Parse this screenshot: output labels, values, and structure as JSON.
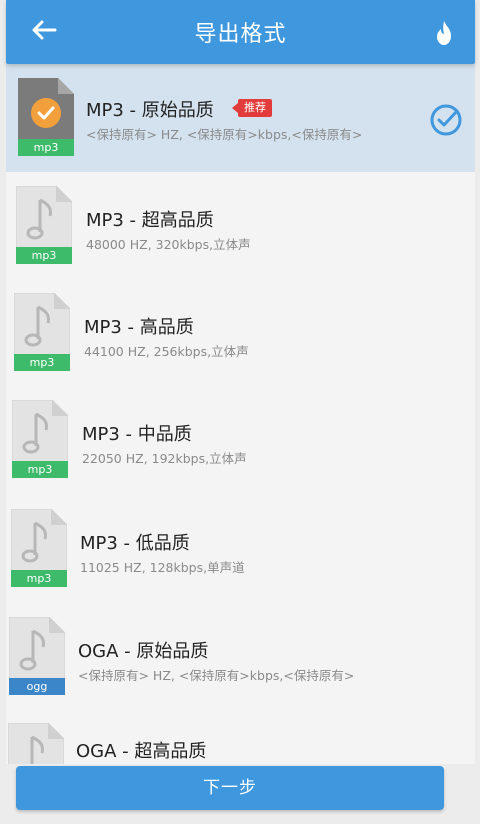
{
  "header": {
    "title": "导出格式",
    "back_icon": "arrow-left-icon",
    "right_icon": "fire-icon"
  },
  "colors": {
    "primary": "#3f98de",
    "selected_row": "#d3e2ee",
    "badge": "#e23b3b",
    "mp3_tag": "#3dbb6b",
    "oga_tag": "#3b86c9",
    "check_orange": "#f2a03c"
  },
  "formats": [
    {
      "title": "MP3 - 原始品质",
      "subtitle": "<保持原有> HZ, <保持原有>kbps,<保持原有>",
      "tag": "mp3",
      "selected": true,
      "badge": "推荐"
    },
    {
      "title": "MP3 - 超高品质",
      "subtitle": "48000 HZ, 320kbps,立体声",
      "tag": "mp3",
      "selected": false
    },
    {
      "title": "MP3 - 高品质",
      "subtitle": "44100 HZ, 256kbps,立体声",
      "tag": "mp3",
      "selected": false
    },
    {
      "title": "MP3 - 中品质",
      "subtitle": "22050 HZ, 192kbps,立体声",
      "tag": "mp3",
      "selected": false
    },
    {
      "title": "MP3 - 低品质",
      "subtitle": "11025 HZ, 128kbps,单声道",
      "tag": "mp3",
      "selected": false
    },
    {
      "title": "OGA - 原始品质",
      "subtitle": "<保持原有> HZ, <保持原有>kbps,<保持原有>",
      "tag": "ogg",
      "selected": false
    },
    {
      "title": "OGA - 超高品质",
      "subtitle": "",
      "tag": "",
      "selected": false
    }
  ],
  "footer": {
    "next_label": "下一步"
  }
}
